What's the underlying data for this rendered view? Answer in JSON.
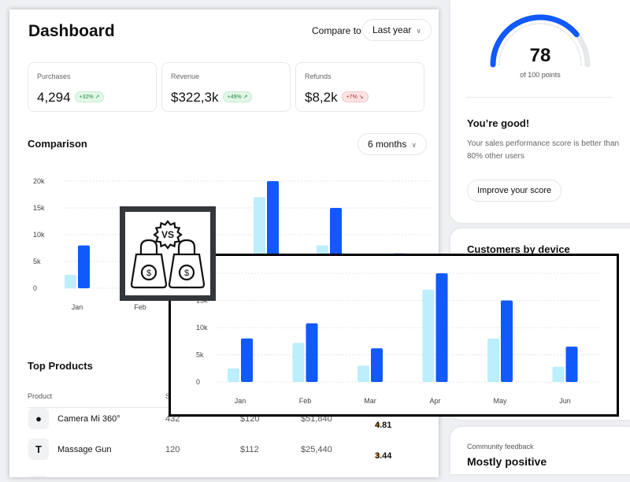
{
  "header": {
    "title": "Dashboard",
    "compare_label": "Compare to",
    "compare_value": "Last year"
  },
  "kpis": [
    {
      "label": "Purchases",
      "value": "4,294",
      "change": "+32%",
      "trend": "up"
    },
    {
      "label": "Revenue",
      "value": "$322,3k",
      "change": "+49%",
      "trend": "up"
    },
    {
      "label": "Refunds",
      "value": "$8,2k",
      "change": "+7%",
      "trend": "down"
    }
  ],
  "comparison": {
    "title": "Comparison",
    "range": "6 months"
  },
  "chart_data": {
    "type": "bar",
    "categories": [
      "Jan",
      "Feb",
      "Mar",
      "Apr",
      "May",
      "Jun"
    ],
    "series": [
      {
        "values": [
          2500,
          7200,
          3000,
          17000,
          8000,
          2800
        ],
        "color": "#bdeefc"
      },
      {
        "values": [
          8000,
          10800,
          6200,
          20000,
          15000,
          6500
        ],
        "color": "#1059fb"
      }
    ],
    "yticks": [
      "0",
      "5k",
      "10k",
      "15k",
      "20k"
    ],
    "ylim": [
      0,
      20000
    ],
    "grid": true
  },
  "products": {
    "title": "Top Products",
    "header_product": "Product",
    "header_partial": "S",
    "rows": [
      {
        "name": "Camera Mi 360°",
        "icon": "camera-icon",
        "glyph": "●",
        "qty": "432",
        "price": "$120",
        "revenue": "$51,840",
        "rating": "4.81"
      },
      {
        "name": "Massage Gun",
        "icon": "massage-gun-icon",
        "glyph": "T",
        "qty": "120",
        "price": "$112",
        "revenue": "$25,440",
        "rating": "3.44"
      }
    ]
  },
  "score": {
    "value": 78,
    "max_label": "of 100 points",
    "fraction": 0.78,
    "title": "You’re good!",
    "text": "Your sales performance score is better than 80% other users",
    "button": "Improve your score"
  },
  "devices": {
    "title": "Customers by device"
  },
  "feedback": {
    "label": "Community feedback",
    "value": "Mostly positive"
  },
  "icons": {
    "vs": "vs-badge-icon",
    "bag": "shopping-bag-dollar-icon"
  }
}
